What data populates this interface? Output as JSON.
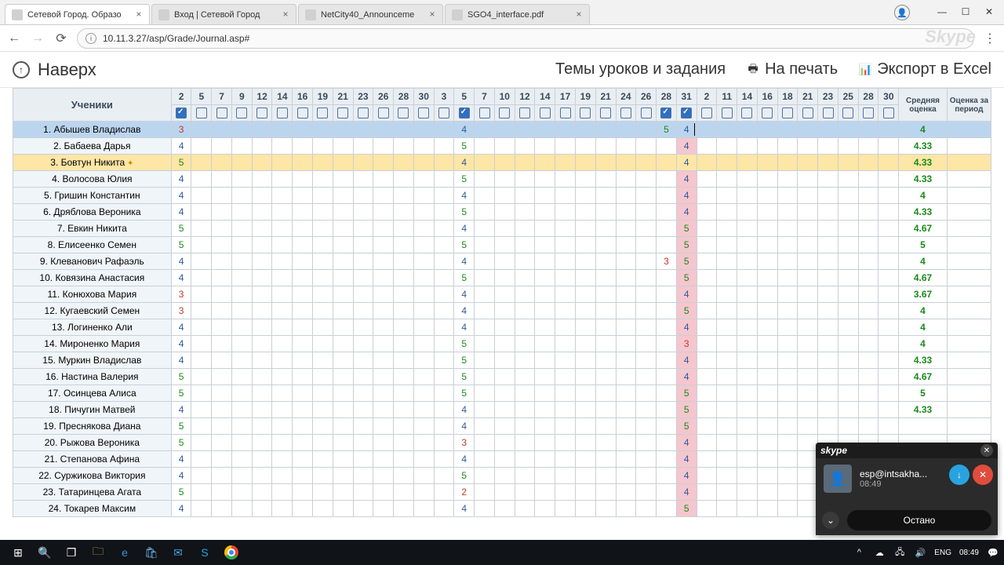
{
  "browser": {
    "tabs": [
      {
        "title": "Сетевой Город. Образо",
        "active": true
      },
      {
        "title": "Вход | Сетевой Город",
        "active": false
      },
      {
        "title": "NetCity40_Announceme",
        "active": false
      },
      {
        "title": "SGO4_interface.pdf",
        "active": false
      }
    ],
    "url": "10.11.3.27/asp/Grade/Journal.asp#",
    "watermark": "Skype"
  },
  "toolbar": {
    "up": "Наверх",
    "themes": "Темы уроков и задания",
    "print": "На печать",
    "export": "Экспорт в Excel"
  },
  "table": {
    "students_header": "Ученики",
    "avg_header": "Средняя оценка",
    "period_header": "Оценка за период",
    "dates": [
      "2",
      "5",
      "7",
      "9",
      "12",
      "14",
      "16",
      "19",
      "21",
      "23",
      "26",
      "28",
      "30",
      "3",
      "5",
      "7",
      "10",
      "12",
      "14",
      "17",
      "19",
      "21",
      "24",
      "26",
      "28",
      "31",
      "2",
      "11",
      "14",
      "16",
      "18",
      "21",
      "23",
      "25",
      "28",
      "30"
    ],
    "checked_cols": [
      0,
      14,
      24,
      25
    ],
    "active_col": 25,
    "students": [
      {
        "n": 1,
        "name": "Абышев Владислав",
        "selected": true,
        "grades": {
          "0": "3",
          "14": "4",
          "24": "5",
          "25": "4"
        },
        "avg": "4",
        "cursor": true
      },
      {
        "n": 2,
        "name": "Бабаева Дарья",
        "grades": {
          "0": "4",
          "14": "5",
          "25": "4"
        },
        "avg": "4.33"
      },
      {
        "n": 3,
        "name": "Бовтун Никита",
        "star": true,
        "grades": {
          "0": "5",
          "14": "4",
          "25": "4"
        },
        "avg": "4.33"
      },
      {
        "n": 4,
        "name": "Волосова Юлия",
        "grades": {
          "0": "4",
          "14": "5",
          "25": "4"
        },
        "avg": "4.33"
      },
      {
        "n": 5,
        "name": "Гришин Константин",
        "grades": {
          "0": "4",
          "14": "4",
          "25": "4"
        },
        "avg": "4"
      },
      {
        "n": 6,
        "name": "Дряблова Вероника",
        "grades": {
          "0": "4",
          "14": "5",
          "25": "4"
        },
        "avg": "4.33"
      },
      {
        "n": 7,
        "name": "Евкин Никита",
        "grades": {
          "0": "5",
          "14": "4",
          "25": "5"
        },
        "avg": "4.67"
      },
      {
        "n": 8,
        "name": "Елисеенко Семен",
        "grades": {
          "0": "5",
          "14": "5",
          "25": "5"
        },
        "avg": "5"
      },
      {
        "n": 9,
        "name": "Клеванович Рафаэль",
        "grades": {
          "0": "4",
          "14": "4",
          "24": "3",
          "25": "5"
        },
        "avg": "4"
      },
      {
        "n": 10,
        "name": "Ковязина Анастасия",
        "grades": {
          "0": "4",
          "14": "5",
          "25": "5"
        },
        "avg": "4.67"
      },
      {
        "n": 11,
        "name": "Конюхова Мария",
        "grades": {
          "0": "3",
          "14": "4",
          "25": "4"
        },
        "avg": "3.67"
      },
      {
        "n": 12,
        "name": "Кугаевский Семен",
        "grades": {
          "0": "3",
          "14": "4",
          "25": "5"
        },
        "avg": "4"
      },
      {
        "n": 13,
        "name": "Логиненко Али",
        "grades": {
          "0": "4",
          "14": "4",
          "25": "4"
        },
        "avg": "4"
      },
      {
        "n": 14,
        "name": "Мироненко Мария",
        "grades": {
          "0": "4",
          "14": "5",
          "25": "3"
        },
        "avg": "4"
      },
      {
        "n": 15,
        "name": "Муркин Владислав",
        "grades": {
          "0": "4",
          "14": "5",
          "25": "4"
        },
        "avg": "4.33"
      },
      {
        "n": 16,
        "name": "Настина Валерия",
        "grades": {
          "0": "5",
          "14": "5",
          "25": "4"
        },
        "avg": "4.67"
      },
      {
        "n": 17,
        "name": "Осинцева Алиса",
        "grades": {
          "0": "5",
          "14": "5",
          "25": "5"
        },
        "avg": "5"
      },
      {
        "n": 18,
        "name": "Пичугин Матвей",
        "grades": {
          "0": "4",
          "14": "4",
          "25": "5"
        },
        "avg": "4.33"
      },
      {
        "n": 19,
        "name": "Преснякова Диана",
        "grades": {
          "0": "5",
          "14": "4",
          "25": "5"
        },
        "avg": ""
      },
      {
        "n": 20,
        "name": "Рыжова Вероника",
        "grades": {
          "0": "5",
          "14": "3",
          "25": "4"
        },
        "avg": ""
      },
      {
        "n": 21,
        "name": "Степанова Афина",
        "grades": {
          "0": "4",
          "14": "4",
          "25": "4"
        },
        "avg": ""
      },
      {
        "n": 22,
        "name": "Суржикова Виктория",
        "grades": {
          "0": "4",
          "14": "5",
          "25": "4"
        },
        "avg": ""
      },
      {
        "n": 23,
        "name": "Татаринцева Агата",
        "grades": {
          "0": "5",
          "14": "2",
          "25": "4"
        },
        "avg": ""
      },
      {
        "n": 24,
        "name": "Токарев Максим",
        "grades": {
          "0": "4",
          "14": "4",
          "25": "5"
        },
        "avg": ""
      }
    ]
  },
  "skype": {
    "logo": "skype",
    "caller": "esp@intsakha...",
    "duration": "08:49",
    "stop": "Остано"
  },
  "taskbar": {
    "lang": "ENG",
    "time": "08:49"
  }
}
